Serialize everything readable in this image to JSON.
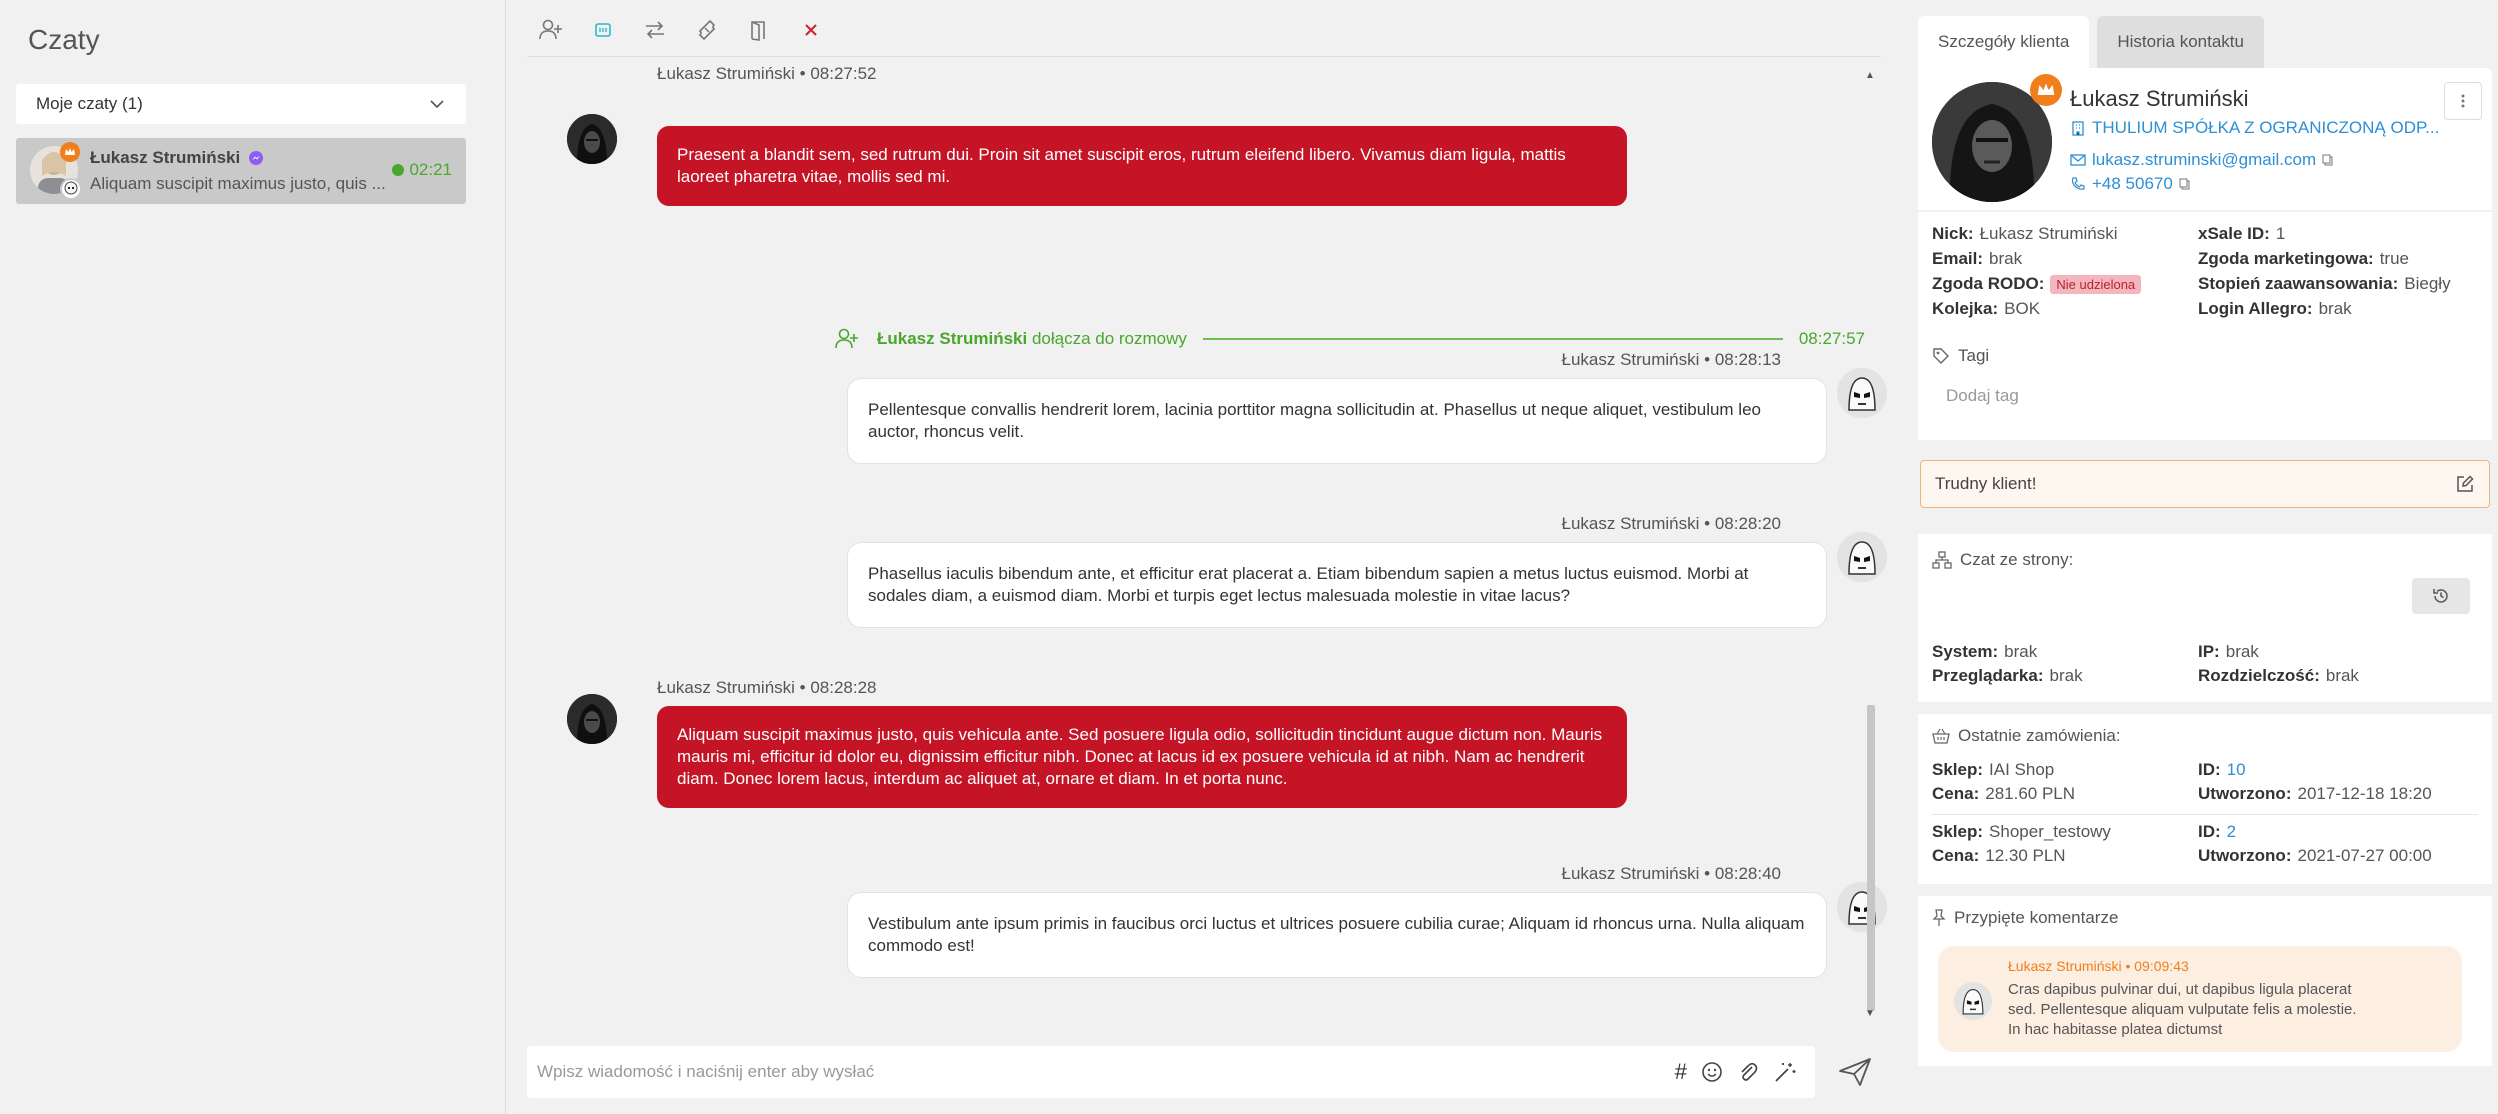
{
  "left": {
    "title": "Czaty",
    "dropdown_label": "Moje czaty (1)",
    "chat": {
      "name": "Łukasz Strumiński",
      "preview": "Aliquam suscipit maximus justo, quis ...",
      "time": "02:21"
    }
  },
  "composer": {
    "placeholder": "Wpisz wiadomość i naciśnij enter aby wysłać",
    "hash": "#"
  },
  "messages": [
    {
      "author": "Łukasz Strumiński",
      "time": "08:27:52",
      "meta": "Łukasz Strumiński • 08:27:52",
      "text": "Praesent a blandit sem, sed rutrum dui. Proin sit amet suscipit eros, rutrum eleifend libero. Vivamus diam ligula, mattis laoreet pharetra vitae, mollis sed mi.",
      "side": "left"
    },
    {
      "author": "Łukasz Strumiński",
      "time": "08:28:13",
      "meta": "Łukasz Strumiński • 08:28:13",
      "text": "Pellentesque convallis hendrerit lorem, lacinia porttitor magna sollicitudin at. Phasellus ut neque aliquet, vestibulum leo auctor, rhoncus velit.",
      "side": "right"
    },
    {
      "author": "Łukasz Strumiński",
      "time": "08:28:20",
      "meta": "Łukasz Strumiński • 08:28:20",
      "text": "Phasellus iaculis bibendum ante, et efficitur erat placerat a. Etiam bibendum sapien a metus luctus euismod. Morbi at sodales diam, a euismod diam. Morbi et turpis eget lectus malesuada molestie in vitae lacus?",
      "side": "right"
    },
    {
      "author": "Łukasz Strumiński",
      "time": "08:28:28",
      "meta": "Łukasz Strumiński • 08:28:28",
      "text": "Aliquam suscipit maximus justo, quis vehicula ante. Sed posuere ligula odio, sollicitudin tincidunt augue dictum non. Mauris mauris mi, efficitur id dolor eu, dignissim efficitur nibh. Donec at lacus id ex posuere vehicula id at nibh. Nam ac hendrerit diam. Donec lorem lacus, interdum ac aliquet at, ornare et diam. In et porta nunc.",
      "side": "left"
    },
    {
      "author": "Łukasz Strumiński",
      "time": "08:28:40",
      "meta": "Łukasz Strumiński • 08:28:40",
      "text": "Vestibulum ante ipsum primis in faucibus orci luctus et ultrices posuere cubilia curae; Aliquam id rhoncus urna. Nulla aliquam commodo est!",
      "side": "right"
    }
  ],
  "join_event": {
    "name": "Łukasz Strumiński",
    "action": " dołącza do rozmowy",
    "time": "08:27:57"
  },
  "right": {
    "tabs": [
      "Szczegóły klienta",
      "Historia kontaktu"
    ],
    "profile": {
      "name": "Łukasz Strumiński",
      "company": "THULIUM SPÓŁKA Z OGRANICZONĄ ODP...",
      "email": "lukasz.struminski@gmail.com",
      "phone": "+48 50670"
    },
    "fields": {
      "nick_label": "Nick:",
      "nick": "Łukasz Strumiński",
      "email_label": "Email:",
      "email": "brak",
      "rodo_label": "Zgoda RODO:",
      "rodo": "Nie udzielona",
      "queue_label": "Kolejka:",
      "queue": "BOK",
      "xsale_label": "xSale ID:",
      "xsale": "1",
      "marketing_label": "Zgoda marketingowa:",
      "marketing": "true",
      "level_label": "Stopień zaawansowania:",
      "level": "Biegły",
      "allegro_label": "Login Allegro:",
      "allegro": "brak"
    },
    "tags": {
      "title": "Tagi",
      "add": "Dodaj tag"
    },
    "warning": "Trudny klient!",
    "source": {
      "title": "Czat ze strony:",
      "system_label": "System:",
      "system": "brak",
      "browser_label": "Przeglądarka:",
      "browser": "brak",
      "ip_label": "IP:",
      "ip": "brak",
      "resolution_label": "Rozdzielczość:",
      "resolution": "brak"
    },
    "orders": {
      "title": "Ostatnie zamówienia:",
      "shop_label": "Sklep:",
      "price_label": "Cena:",
      "id_label": "ID:",
      "created_label": "Utworzono:",
      "items": [
        {
          "shop": "IAI Shop",
          "price": "281.60 PLN",
          "id": "10",
          "created": "2017-12-18 18:20"
        },
        {
          "shop": "Shoper_testowy",
          "price": "12.30 PLN",
          "id": "2",
          "created": "2021-07-27 00:00"
        }
      ]
    },
    "pinned": {
      "title": "Przypięte komentarze",
      "meta": "Łukasz Strumiński • 09:09:43",
      "text": "Cras dapibus pulvinar dui, ut dapibus ligula placerat sed. Pellentesque aliquam vulputate felis a molestie. In hac habitasse platea dictumst"
    }
  },
  "colors": {
    "accent_green": "#4aa72e",
    "accent_red": "#c41425",
    "accent_orange": "#f07e1b",
    "link_blue": "#2d8fd5"
  }
}
